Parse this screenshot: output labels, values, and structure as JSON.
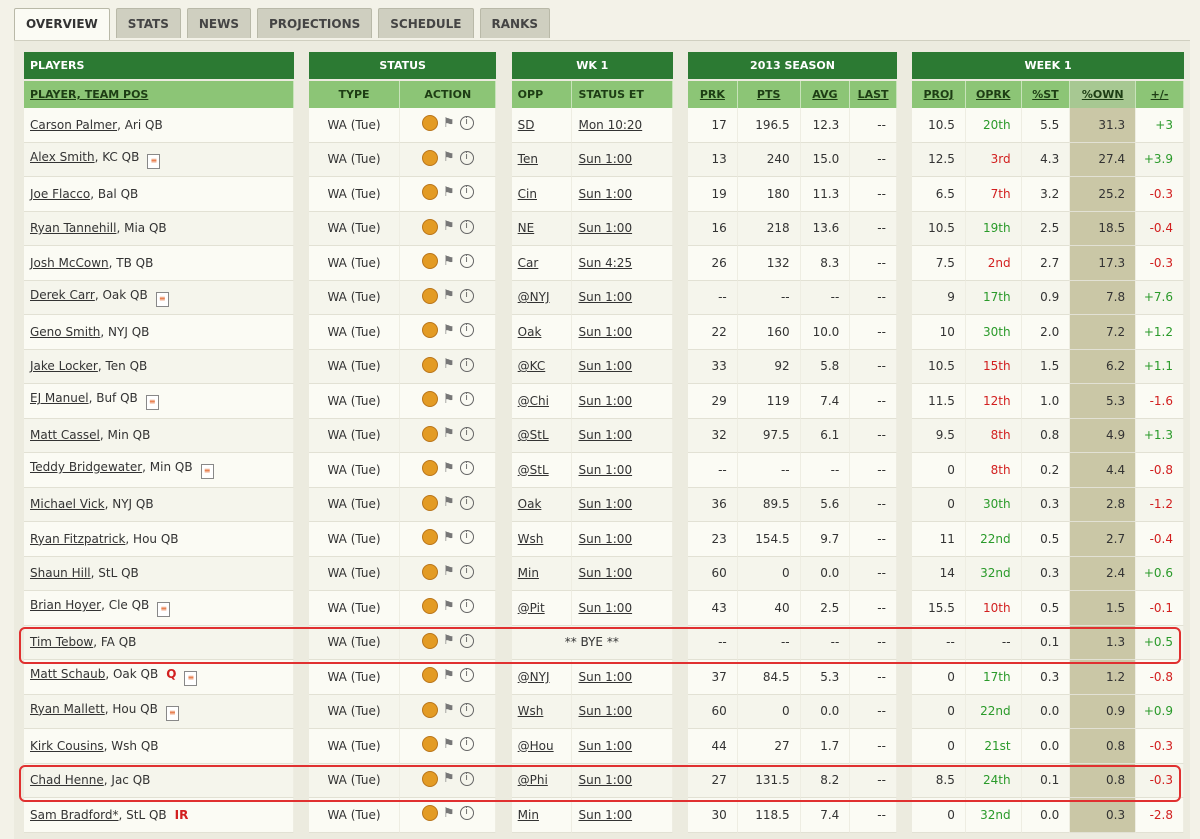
{
  "tabs": [
    "OVERVIEW",
    "STATS",
    "NEWS",
    "PROJECTIONS",
    "SCHEDULE",
    "RANKS"
  ],
  "groups": {
    "players": "PLAYERS",
    "status": "STATUS",
    "wk": "WK 1",
    "season": "2013 SEASON",
    "week": "WEEK 1"
  },
  "headers": {
    "player": "PLAYER, TEAM POS",
    "type": "TYPE",
    "action": "ACTION",
    "opp": "OPP",
    "status_et": "STATUS ET",
    "prk": "PRK",
    "pts": "PTS",
    "avg": "AVG",
    "last": "LAST",
    "proj": "PROJ",
    "oprk": "OPRK",
    "pst": "%ST",
    "pown": "%OWN",
    "pm": "+/-"
  },
  "colors": {
    "header_dark": "#2c7a33",
    "header_light": "#8cc576",
    "own_col": "#cac7a6",
    "negative": "#d21f1f",
    "positive": "#2a9a2a",
    "highlight": "#e03030"
  },
  "rows": [
    {
      "name": "Carson Palmer",
      "team": ", Ari QB",
      "type": "WA (Tue)",
      "opp": "SD",
      "time": "Mon 10:20",
      "prk": "17",
      "pts": "196.5",
      "avg": "12.3",
      "last": "--",
      "proj": "10.5",
      "oprk": "20th",
      "oprk_c": "green",
      "pst": "5.5",
      "pown": "31.3",
      "pm": "+3",
      "pm_c": "green"
    },
    {
      "name": "Alex Smith",
      "team": ", KC QB",
      "type": "WA (Tue)",
      "opp": "Ten",
      "time": "Sun 1:00",
      "prk": "13",
      "pts": "240",
      "avg": "15.0",
      "last": "--",
      "proj": "12.5",
      "oprk": "3rd",
      "oprk_c": "red",
      "pst": "4.3",
      "pown": "27.4",
      "pm": "+3.9",
      "pm_c": "green",
      "note": true
    },
    {
      "name": "Joe Flacco",
      "team": ", Bal QB",
      "type": "WA (Tue)",
      "opp": "Cin",
      "time": "Sun 1:00",
      "prk": "19",
      "pts": "180",
      "avg": "11.3",
      "last": "--",
      "proj": "6.5",
      "oprk": "7th",
      "oprk_c": "red",
      "pst": "3.2",
      "pown": "25.2",
      "pm": "-0.3",
      "pm_c": "red"
    },
    {
      "name": "Ryan Tannehill",
      "team": ", Mia QB",
      "type": "WA (Tue)",
      "opp": "NE",
      "time": "Sun 1:00",
      "prk": "16",
      "pts": "218",
      "avg": "13.6",
      "last": "--",
      "proj": "10.5",
      "oprk": "19th",
      "oprk_c": "green",
      "pst": "2.5",
      "pown": "18.5",
      "pm": "-0.4",
      "pm_c": "red"
    },
    {
      "name": "Josh McCown",
      "team": ", TB QB",
      "type": "WA (Tue)",
      "opp": "Car",
      "time": "Sun 4:25",
      "prk": "26",
      "pts": "132",
      "avg": "8.3",
      "last": "--",
      "proj": "7.5",
      "oprk": "2nd",
      "oprk_c": "red",
      "pst": "2.7",
      "pown": "17.3",
      "pm": "-0.3",
      "pm_c": "red"
    },
    {
      "name": "Derek Carr",
      "team": ", Oak QB",
      "type": "WA (Tue)",
      "opp": "@NYJ",
      "time": "Sun 1:00",
      "prk": "--",
      "pts": "--",
      "avg": "--",
      "last": "--",
      "proj": "9",
      "oprk": "17th",
      "oprk_c": "green",
      "pst": "0.9",
      "pown": "7.8",
      "pm": "+7.6",
      "pm_c": "green",
      "note": true
    },
    {
      "name": "Geno Smith",
      "team": ", NYJ QB",
      "type": "WA (Tue)",
      "opp": "Oak",
      "time": "Sun 1:00",
      "prk": "22",
      "pts": "160",
      "avg": "10.0",
      "last": "--",
      "proj": "10",
      "oprk": "30th",
      "oprk_c": "green",
      "pst": "2.0",
      "pown": "7.2",
      "pm": "+1.2",
      "pm_c": "green"
    },
    {
      "name": "Jake Locker",
      "team": ", Ten QB",
      "type": "WA (Tue)",
      "opp": "@KC",
      "time": "Sun 1:00",
      "prk": "33",
      "pts": "92",
      "avg": "5.8",
      "last": "--",
      "proj": "10.5",
      "oprk": "15th",
      "oprk_c": "red",
      "pst": "1.5",
      "pown": "6.2",
      "pm": "+1.1",
      "pm_c": "green"
    },
    {
      "name": "EJ Manuel",
      "team": ", Buf QB",
      "type": "WA (Tue)",
      "opp": "@Chi",
      "time": "Sun 1:00",
      "prk": "29",
      "pts": "119",
      "avg": "7.4",
      "last": "--",
      "proj": "11.5",
      "oprk": "12th",
      "oprk_c": "red",
      "pst": "1.0",
      "pown": "5.3",
      "pm": "-1.6",
      "pm_c": "red",
      "note": true
    },
    {
      "name": "Matt Cassel",
      "team": ", Min QB",
      "type": "WA (Tue)",
      "opp": "@StL",
      "time": "Sun 1:00",
      "prk": "32",
      "pts": "97.5",
      "avg": "6.1",
      "last": "--",
      "proj": "9.5",
      "oprk": "8th",
      "oprk_c": "red",
      "pst": "0.8",
      "pown": "4.9",
      "pm": "+1.3",
      "pm_c": "green"
    },
    {
      "name": "Teddy Bridgewater",
      "team": ", Min QB",
      "type": "WA (Tue)",
      "opp": "@StL",
      "time": "Sun 1:00",
      "prk": "--",
      "pts": "--",
      "avg": "--",
      "last": "--",
      "proj": "0",
      "oprk": "8th",
      "oprk_c": "red",
      "pst": "0.2",
      "pown": "4.4",
      "pm": "-0.8",
      "pm_c": "red",
      "note": true
    },
    {
      "name": "Michael Vick",
      "team": ", NYJ QB",
      "type": "WA (Tue)",
      "opp": "Oak",
      "time": "Sun 1:00",
      "prk": "36",
      "pts": "89.5",
      "avg": "5.6",
      "last": "--",
      "proj": "0",
      "oprk": "30th",
      "oprk_c": "green",
      "pst": "0.3",
      "pown": "2.8",
      "pm": "-1.2",
      "pm_c": "red"
    },
    {
      "name": "Ryan Fitzpatrick",
      "team": ", Hou QB",
      "type": "WA (Tue)",
      "opp": "Wsh",
      "time": "Sun 1:00",
      "prk": "23",
      "pts": "154.5",
      "avg": "9.7",
      "last": "--",
      "proj": "11",
      "oprk": "22nd",
      "oprk_c": "green",
      "pst": "0.5",
      "pown": "2.7",
      "pm": "-0.4",
      "pm_c": "red"
    },
    {
      "name": "Shaun Hill",
      "team": ", StL QB",
      "type": "WA (Tue)",
      "opp": "Min",
      "time": "Sun 1:00",
      "prk": "60",
      "pts": "0",
      "avg": "0.0",
      "last": "--",
      "proj": "14",
      "oprk": "32nd",
      "oprk_c": "green",
      "pst": "0.3",
      "pown": "2.4",
      "pm": "+0.6",
      "pm_c": "green"
    },
    {
      "name": "Brian Hoyer",
      "team": ", Cle QB",
      "type": "WA (Tue)",
      "opp": "@Pit",
      "time": "Sun 1:00",
      "prk": "43",
      "pts": "40",
      "avg": "2.5",
      "last": "--",
      "proj": "15.5",
      "oprk": "10th",
      "oprk_c": "red",
      "pst": "0.5",
      "pown": "1.5",
      "pm": "-0.1",
      "pm_c": "red",
      "note": true
    },
    {
      "name": "Tim Tebow",
      "team": ", FA QB",
      "type": "WA (Tue)",
      "bye": "** BYE **",
      "prk": "--",
      "pts": "--",
      "avg": "--",
      "last": "--",
      "proj": "--",
      "oprk": "--",
      "oprk_c": "",
      "pst": "0.1",
      "pown": "1.3",
      "pm": "+0.5",
      "pm_c": "green"
    },
    {
      "name": "Matt Schaub",
      "team": ", Oak QB",
      "type": "WA (Tue)",
      "opp": "@NYJ",
      "time": "Sun 1:00",
      "prk": "37",
      "pts": "84.5",
      "avg": "5.3",
      "last": "--",
      "proj": "0",
      "oprk": "17th",
      "oprk_c": "green",
      "pst": "0.3",
      "pown": "1.2",
      "pm": "-0.8",
      "pm_c": "red",
      "q": "Q",
      "note": true
    },
    {
      "name": "Ryan Mallett",
      "team": ", Hou QB",
      "type": "WA (Tue)",
      "opp": "Wsh",
      "time": "Sun 1:00",
      "prk": "60",
      "pts": "0",
      "avg": "0.0",
      "last": "--",
      "proj": "0",
      "oprk": "22nd",
      "oprk_c": "green",
      "pst": "0.0",
      "pown": "0.9",
      "pm": "+0.9",
      "pm_c": "green",
      "note": true
    },
    {
      "name": "Kirk Cousins",
      "team": ", Wsh QB",
      "type": "WA (Tue)",
      "opp": "@Hou",
      "time": "Sun 1:00",
      "prk": "44",
      "pts": "27",
      "avg": "1.7",
      "last": "--",
      "proj": "0",
      "oprk": "21st",
      "oprk_c": "green",
      "pst": "0.0",
      "pown": "0.8",
      "pm": "-0.3",
      "pm_c": "red"
    },
    {
      "name": "Chad Henne",
      "team": ", Jac QB",
      "type": "WA (Tue)",
      "opp": "@Phi",
      "time": "Sun 1:00",
      "prk": "27",
      "pts": "131.5",
      "avg": "8.2",
      "last": "--",
      "proj": "8.5",
      "oprk": "24th",
      "oprk_c": "green",
      "pst": "0.1",
      "pown": "0.8",
      "pm": "-0.3",
      "pm_c": "red"
    },
    {
      "name": "Sam Bradford*",
      "team": ", StL QB",
      "type": "WA (Tue)",
      "opp": "Min",
      "time": "Sun 1:00",
      "prk": "30",
      "pts": "118.5",
      "avg": "7.4",
      "last": "--",
      "proj": "0",
      "oprk": "32nd",
      "oprk_c": "green",
      "pst": "0.0",
      "pown": "0.3",
      "pm": "-2.8",
      "pm_c": "red",
      "ir": "IR"
    }
  ]
}
